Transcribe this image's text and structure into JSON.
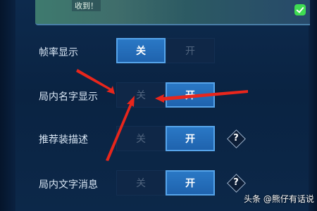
{
  "banner": {
    "text": "收到！"
  },
  "settings": [
    {
      "label": "帧率显示",
      "off_label": "关",
      "on_label": "开",
      "selected": "off",
      "has_help": false
    },
    {
      "label": "局内名字显示",
      "off_label": "关",
      "on_label": "开",
      "selected": "on",
      "has_help": false
    },
    {
      "label": "推荐装描述",
      "off_label": "关",
      "on_label": "开",
      "selected": "on",
      "has_help": true
    },
    {
      "label": "局内文字消息",
      "off_label": "关",
      "on_label": "开",
      "selected": "on",
      "has_help": true
    }
  ],
  "help_icon_text": "?",
  "watermark": "头条 @熊仔有话说",
  "colors": {
    "selected_segment": "#2a78c5",
    "unselected_segment": "#0f2747",
    "annotation_arrow": "#e8261c"
  }
}
